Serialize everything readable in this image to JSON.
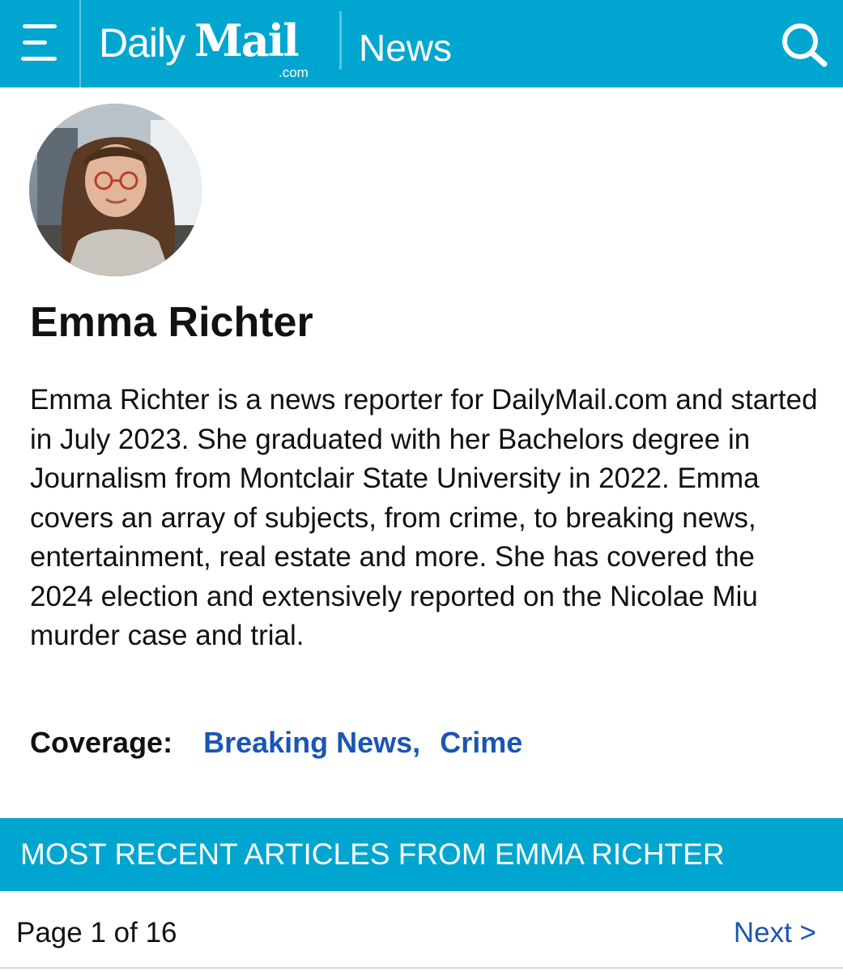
{
  "header": {
    "logo_daily": "Daily",
    "logo_mail": "Mail",
    "logo_com": ".com",
    "section": "News",
    "bar_color": "#00a6cf",
    "menu_icon": "hamburger-icon",
    "search_icon": "search-icon"
  },
  "author": {
    "name": "Emma Richter",
    "bio": "Emma Richter is a news reporter for DailyMail.com and started in July 2023. She graduated with her Bachelors degree in Journalism from Montclair State University in 2022. Emma covers an array of subjects, from crime, to breaking news, entertainment, real estate and more. She has covered the 2024 election and extensively reported on the Nicolae Miu murder case and trial."
  },
  "coverage": {
    "label": "Coverage:",
    "items": [
      "Breaking News,",
      "Crime"
    ],
    "link_color": "#1a56b3"
  },
  "recent": {
    "title": "MOST RECENT ARTICLES FROM EMMA RICHTER"
  },
  "pagination": {
    "page_text": "Page 1 of 16",
    "next_label": "Next >"
  }
}
